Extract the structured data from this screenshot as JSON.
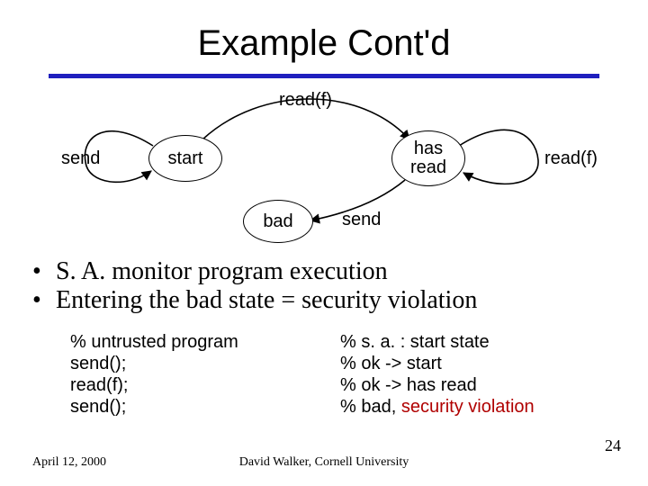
{
  "title": "Example Cont'd",
  "diagram": {
    "states": {
      "start": "start",
      "has_read": "has\nread",
      "bad": "bad"
    },
    "edge_labels": {
      "start_loop": "send",
      "start_to_hasread": "read(f)",
      "hasread_loop": "read(f)",
      "hasread_to_bad": "send"
    }
  },
  "bullets": [
    "S. A. monitor program execution",
    "Entering the bad state = security violation"
  ],
  "left_col": [
    "% untrusted program",
    "send();",
    "read(f);",
    "send();"
  ],
  "right_col": [
    {
      "text": "% s. a. : start state",
      "violation": false
    },
    {
      "text": "% ok -> start",
      "violation": false
    },
    {
      "text": "% ok -> has read",
      "violation": false
    },
    {
      "prefix": "% bad, ",
      "text": "security violation",
      "violation": true
    }
  ],
  "footer": {
    "date": "April 12, 2000",
    "center": "David Walker, Cornell University",
    "page": "24"
  }
}
